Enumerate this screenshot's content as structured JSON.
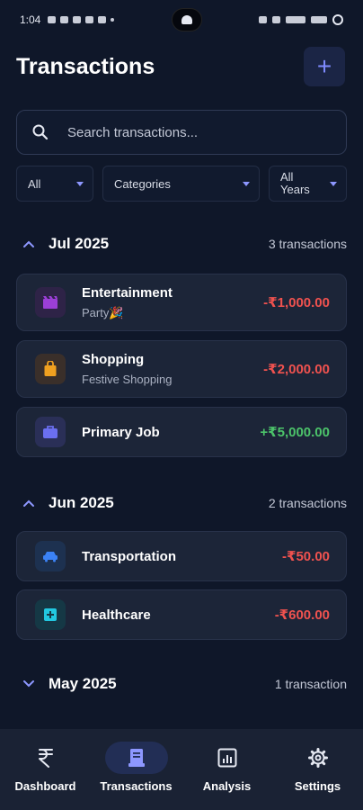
{
  "status_bar": {
    "time": "1:04"
  },
  "header": {
    "title": "Transactions",
    "add_label": "+"
  },
  "search": {
    "placeholder": "Search transactions..."
  },
  "filters": {
    "type": "All",
    "category": "Categories",
    "year_line1": "All",
    "year_line2": "Years"
  },
  "groups": [
    {
      "title": "Jul 2025",
      "count": "3 transactions",
      "expanded": true,
      "items": [
        {
          "title": "Entertainment",
          "subtitle": "Party🎉",
          "amount": "-₹1,000.00",
          "icon": "movie-icon",
          "icon_color": "#9b3fd6",
          "icon_bg": "#2e2347"
        },
        {
          "title": "Shopping",
          "subtitle": "Festive Shopping",
          "amount": "-₹2,000.00",
          "icon": "shopping-bag-icon",
          "icon_color": "#f0a020",
          "icon_bg": "#3a2f2a"
        },
        {
          "title": "Primary Job",
          "subtitle": "",
          "amount": "+₹5,000.00",
          "icon": "briefcase-icon",
          "icon_color": "#6b6ff0",
          "icon_bg": "#2a2f57"
        }
      ]
    },
    {
      "title": "Jun 2025",
      "count": "2 transactions",
      "expanded": true,
      "items": [
        {
          "title": "Transportation",
          "subtitle": "",
          "amount": "-₹50.00",
          "icon": "car-icon",
          "icon_color": "#3b82f6",
          "icon_bg": "#1d3150"
        },
        {
          "title": "Healthcare",
          "subtitle": "",
          "amount": "-₹600.00",
          "icon": "medical-icon",
          "icon_color": "#22c8e0",
          "icon_bg": "#153845"
        }
      ]
    },
    {
      "title": "May 2025",
      "count": "1 transaction",
      "expanded": false,
      "items": []
    }
  ],
  "nav": [
    {
      "label": "Dashboard",
      "icon": "rupee-icon",
      "active": false
    },
    {
      "label": "Transactions",
      "icon": "receipt-icon",
      "active": true
    },
    {
      "label": "Analysis",
      "icon": "chart-icon",
      "active": false
    },
    {
      "label": "Settings",
      "icon": "gear-icon",
      "active": false
    }
  ],
  "colors": {
    "background": "#0f1729",
    "accent": "#7f8bff",
    "negative": "#f0524f",
    "positive": "#4cc36a"
  }
}
